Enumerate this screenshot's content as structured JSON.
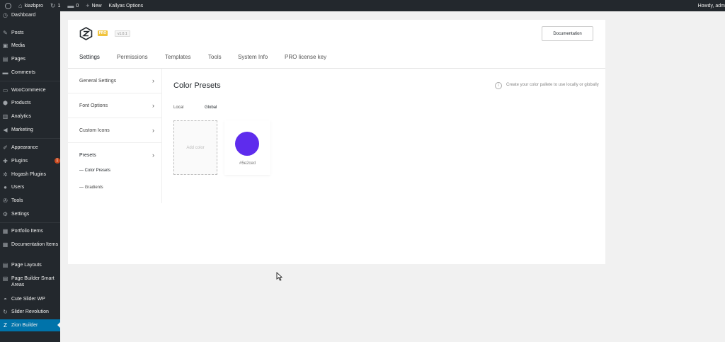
{
  "admin_bar": {
    "site_name": "kiazbpro",
    "updates_count": "1",
    "comments_count": "0",
    "new_label": "New",
    "kallyas_label": "Kallyas Options",
    "howdy": "Howdy, adm"
  },
  "sidebar": {
    "items": [
      {
        "label": "Dashboard",
        "icon": "dashboard-icon",
        "glyph": "◷"
      },
      {
        "label": "Posts",
        "icon": "pin-icon",
        "glyph": "✎"
      },
      {
        "label": "Media",
        "icon": "media-icon",
        "glyph": "▣"
      },
      {
        "label": "Pages",
        "icon": "pages-icon",
        "glyph": "▤"
      },
      {
        "label": "Comments",
        "icon": "comments-icon",
        "glyph": "▬"
      },
      {
        "label": "WooCommerce",
        "icon": "woocommerce-icon",
        "glyph": "▭"
      },
      {
        "label": "Products",
        "icon": "products-icon",
        "glyph": "⬢"
      },
      {
        "label": "Analytics",
        "icon": "analytics-icon",
        "glyph": "▥"
      },
      {
        "label": "Marketing",
        "icon": "megaphone-icon",
        "glyph": "◀"
      },
      {
        "label": "Appearance",
        "icon": "brush-icon",
        "glyph": "✐"
      },
      {
        "label": "Plugins",
        "icon": "plugin-icon",
        "glyph": "✚",
        "badge": "1"
      },
      {
        "label": "Hogash Plugins",
        "icon": "gear-icon",
        "glyph": "✲"
      },
      {
        "label": "Users",
        "icon": "users-icon",
        "glyph": "●"
      },
      {
        "label": "Tools",
        "icon": "wrench-icon",
        "glyph": "✇"
      },
      {
        "label": "Settings",
        "icon": "settings-icon",
        "glyph": "⚙"
      },
      {
        "label": "Portfolio Items",
        "icon": "portfolio-icon",
        "glyph": "▦"
      },
      {
        "label": "Documentation Items",
        "icon": "documentation-icon",
        "glyph": "▦"
      },
      {
        "label": "Page Layouts",
        "icon": "layouts-icon",
        "glyph": "▤"
      },
      {
        "label": "Page Builder Smart Areas",
        "icon": "smart-areas-icon",
        "glyph": "▤"
      },
      {
        "label": "Cute Slider WP",
        "icon": "slider-icon",
        "glyph": "◓"
      },
      {
        "label": "Slider Revolution",
        "icon": "revolution-icon",
        "glyph": "↻"
      },
      {
        "label": "Zion Builder",
        "icon": "zion-icon",
        "glyph": "Z"
      }
    ]
  },
  "header": {
    "pro_badge": "PRO",
    "version": "v1.0.1",
    "documentation_button": "Documentation",
    "tabs": [
      "Settings",
      "Permissions",
      "Templates",
      "Tools",
      "System Info",
      "PRO license key"
    ]
  },
  "left_nav": {
    "items": [
      "General Settings",
      "Font Options",
      "Custom Icons",
      "Presets"
    ],
    "sub_items": [
      "— Color Presets",
      "— Gradients"
    ]
  },
  "content": {
    "title": "Color Presets",
    "subtabs": [
      "Local",
      "Global"
    ],
    "info_text": "Create your color pallete to use locally or globally",
    "add_color_label": "Add color",
    "presets": [
      {
        "color": "#5e2ced",
        "label": "#5e2ced"
      }
    ]
  },
  "colors": {
    "admin_bar_bg": "#23282d",
    "sidebar_bg": "#23282d",
    "active_menu_bg": "#0073aa",
    "pro_badge_bg": "#f0c33c",
    "plugins_badge_bg": "#ca4a1f"
  }
}
